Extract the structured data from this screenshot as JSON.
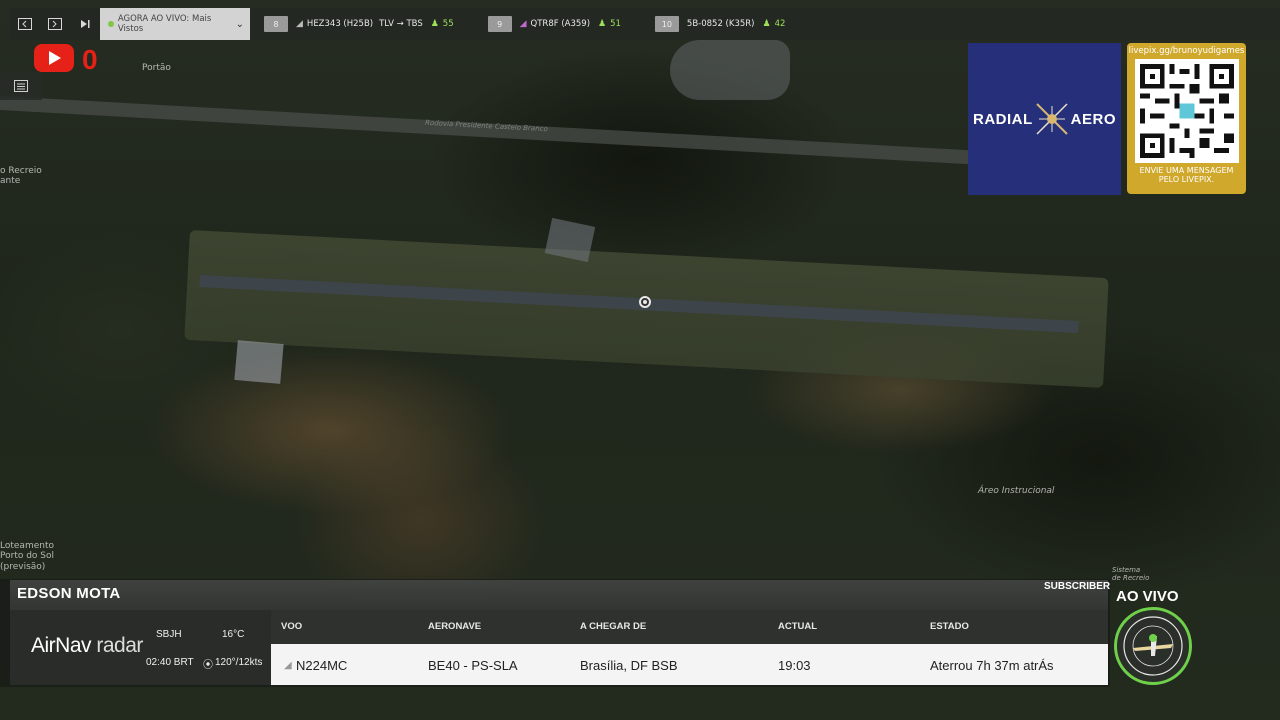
{
  "topbar": {
    "live_label": "AGORA AO VIVO: Mais Vistos",
    "flights": [
      {
        "index": "8",
        "callsign": "HEZ343 (H25B)",
        "route": "TLV → TBS",
        "viewers": "55"
      },
      {
        "index": "9",
        "callsign": "QTR8F (A359)",
        "route": "",
        "viewers": "51"
      },
      {
        "index": "10",
        "callsign": "5B-0852 (K35R)",
        "route": "",
        "viewers": "42"
      }
    ]
  },
  "youtube": {
    "count": "0"
  },
  "map": {
    "labels": {
      "portao": "Portão",
      "recreio": "o Recreio\nante",
      "rodovia": "Rodovia Presidente Castelo Branco",
      "loteamento": "Loteamento\nPorto do Sol\n(previsão)",
      "areo": "Áreo Instrucional",
      "sistema": "Sistema\nde Recreio"
    }
  },
  "sponsor": {
    "radial_left": "RADIAL",
    "radial_right": "AERO",
    "qr_url": "livepix.gg/brunoyudigames",
    "qr_message": "ENVIE UMA MENSAGEM PELO LIVEPIX."
  },
  "panel": {
    "streamer": "EDSON MOTA",
    "subscriber_label": "SUBSCRIBER",
    "brand_main": "AirNav",
    "brand_sub": " radar",
    "airport": "SBJH",
    "temperature": "16°C",
    "time": "02:40 BRT",
    "wind": "120°/12kts",
    "columns": [
      "VOO",
      "AERONAVE",
      "A CHEGAR DE",
      "ACTUAL",
      "ESTADO"
    ],
    "row": {
      "voo": "N224MC",
      "aeronave": "BE40 - PS-SLA",
      "origem": "Brasília, DF BSB",
      "actual": "19:03",
      "estado": "Aterrou 7h 37m atrÁs"
    },
    "live_badge": "AO VIVO"
  }
}
